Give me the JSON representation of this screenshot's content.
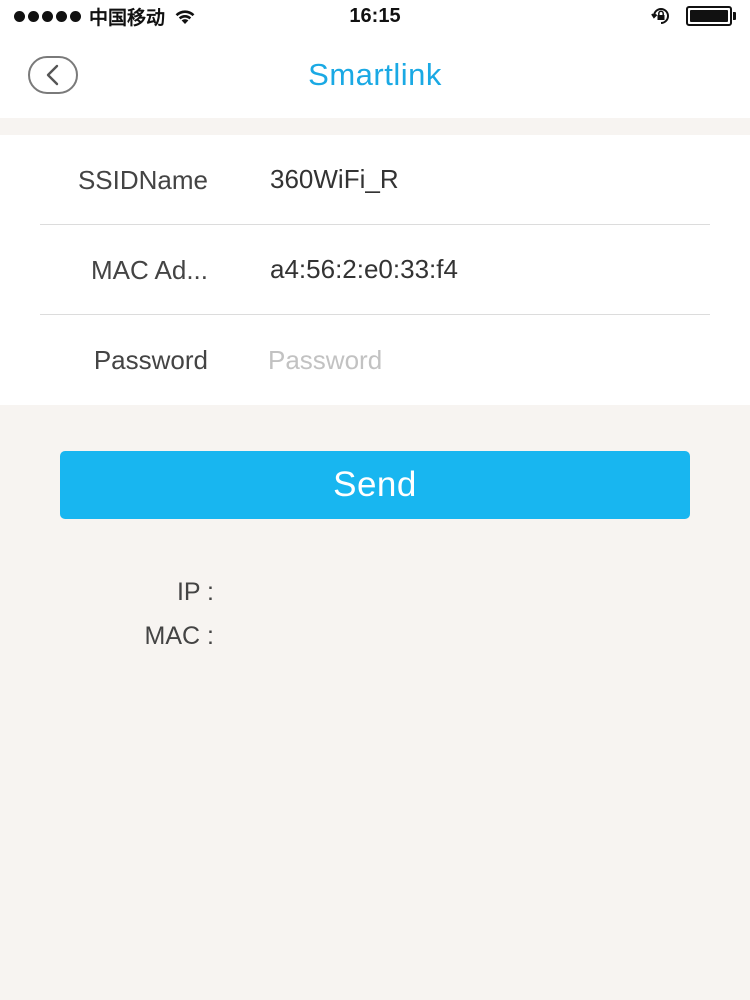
{
  "status_bar": {
    "carrier": "中国移动",
    "time": "16:15",
    "icons": [
      "signal-dots",
      "wifi-icon",
      "rotation-lock-icon",
      "battery-icon"
    ]
  },
  "nav": {
    "title": "Smartlink",
    "back_icon": "chevron-left-icon"
  },
  "form": {
    "ssid": {
      "label": "SSIDName",
      "value": "360WiFi_R"
    },
    "mac": {
      "label": "MAC Ad...",
      "value": "a4:56:2:e0:33:f4"
    },
    "password": {
      "label": "Password",
      "placeholder": "Password",
      "value": ""
    }
  },
  "send_label": "Send",
  "result": {
    "ip_label": "IP :",
    "mac_label": "MAC :"
  },
  "colors": {
    "accent": "#1aa9e4",
    "button": "#18b6f0",
    "background": "#f7f4f1"
  }
}
